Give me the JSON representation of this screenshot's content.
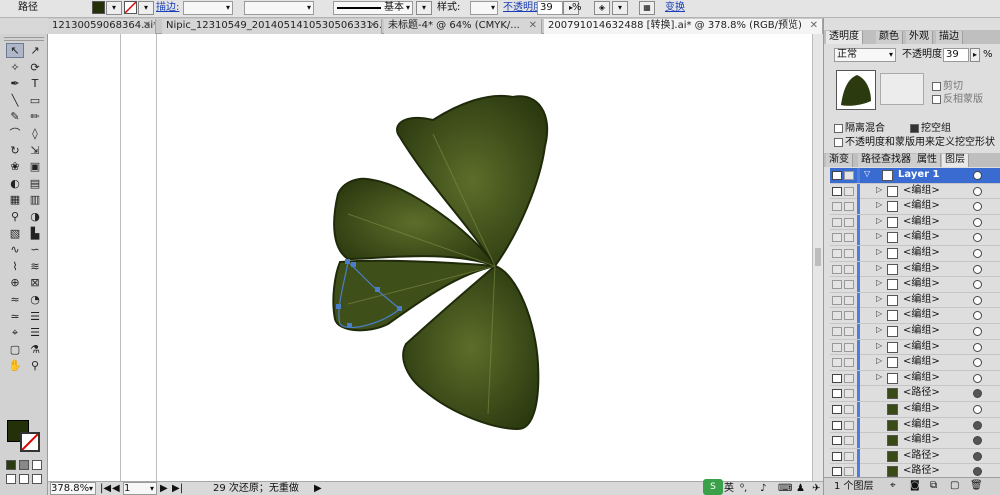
{
  "control_bar": {
    "object_type": "路径",
    "stroke_label": "描边:",
    "stroke_profile": "基本",
    "style_label": "样式:",
    "opacity_label": "不透明度:",
    "opacity_value": "39",
    "opacity_unit": "%",
    "transform_label": "变换"
  },
  "tabs": [
    {
      "label": "12130059068364.ai*"
    },
    {
      "label": "Nipic_12310549_20140514105305063316.ai*"
    },
    {
      "label": "未标题-4* @ 64% (CMYK/..."
    },
    {
      "label": "200791014632488 [转换].ai* @ 378.8% (RGB/预览)"
    }
  ],
  "status": {
    "zoom": "378.8%",
    "page": "1",
    "undo_text": "29 次还原；无重做"
  },
  "ime": {
    "mode": "英"
  },
  "transparency_panel": {
    "tabs": [
      "透明度",
      "颜色",
      "外观",
      "描边"
    ],
    "blend_mode": "正常",
    "opacity_label": "不透明度:",
    "opacity_value": "39",
    "opacity_unit": "%",
    "clip_label": "剪切",
    "invert_mask_label": "反相蒙版",
    "isolate_label": "隔离混合",
    "knockout_label": "挖空组",
    "define_knockout_label": "不透明度和蒙版用来定义挖空形状"
  },
  "layers_panel": {
    "tabs": [
      "渐变",
      "路径查找器",
      "属性",
      "图层"
    ],
    "rows": [
      {
        "name": "Layer 1",
        "top": true,
        "eye": true,
        "tri": "▽",
        "target_filled": false
      },
      {
        "name": "<编组>",
        "eye": true,
        "tri": "▷",
        "target_filled": false
      },
      {
        "name": "<编组>",
        "eye": false,
        "tri": "▷",
        "target_filled": false
      },
      {
        "name": "<编组>",
        "eye": false,
        "tri": "▷",
        "target_filled": false
      },
      {
        "name": "<编组>",
        "eye": false,
        "tri": "▷",
        "target_filled": false
      },
      {
        "name": "<编组>",
        "eye": false,
        "tri": "▷",
        "target_filled": false
      },
      {
        "name": "<编组>",
        "eye": false,
        "tri": "▷",
        "target_filled": false
      },
      {
        "name": "<编组>",
        "eye": false,
        "tri": "▷",
        "target_filled": false
      },
      {
        "name": "<编组>",
        "eye": false,
        "tri": "▷",
        "target_filled": false
      },
      {
        "name": "<编组>",
        "eye": false,
        "tri": "▷",
        "target_filled": false
      },
      {
        "name": "<编组>",
        "eye": false,
        "tri": "▷",
        "target_filled": false
      },
      {
        "name": "<编组>",
        "eye": false,
        "tri": "▷",
        "target_filled": false
      },
      {
        "name": "<编组>",
        "eye": false,
        "tri": "▷",
        "target_filled": false
      },
      {
        "name": "<编组>",
        "eye": true,
        "tri": "▷",
        "target_filled": false
      },
      {
        "name": "<路径>",
        "eye": true,
        "tri": "",
        "target_filled": true
      },
      {
        "name": "<编组>",
        "eye": true,
        "tri": "",
        "target_filled": false
      },
      {
        "name": "<编组>",
        "eye": true,
        "tri": "",
        "target_filled": true
      },
      {
        "name": "<编组>",
        "eye": true,
        "tri": "",
        "target_filled": true
      },
      {
        "name": "<路径>",
        "eye": true,
        "tri": "",
        "target_filled": true
      },
      {
        "name": "<路径>",
        "eye": true,
        "tri": "",
        "target_filled": true
      }
    ],
    "footer_count": "1 个图层"
  },
  "tools": [
    {
      "glyph": "↖",
      "name": "selection-tool",
      "sel": true
    },
    {
      "glyph": "↗",
      "name": "direct-selection-tool"
    },
    {
      "glyph": "✧",
      "name": "magic-wand-tool"
    },
    {
      "glyph": "⟳",
      "name": "lasso-tool"
    },
    {
      "glyph": "✒",
      "name": "pen-tool"
    },
    {
      "glyph": "T",
      "name": "type-tool"
    },
    {
      "glyph": "╲",
      "name": "line-tool"
    },
    {
      "glyph": "▭",
      "name": "rectangle-tool"
    },
    {
      "glyph": "✎",
      "name": "paintbrush-tool"
    },
    {
      "glyph": "✏",
      "name": "pencil-tool"
    },
    {
      "glyph": "⌒",
      "name": "blob-brush-tool"
    },
    {
      "glyph": "◊",
      "name": "eraser-tool"
    },
    {
      "glyph": "↻",
      "name": "rotate-tool"
    },
    {
      "glyph": "⇲",
      "name": "scale-tool"
    },
    {
      "glyph": "❀",
      "name": "warp-tool"
    },
    {
      "glyph": "▣",
      "name": "free-transform-tool"
    },
    {
      "glyph": "◐",
      "name": "shape-builder-tool"
    },
    {
      "glyph": "▤",
      "name": "perspective-grid-tool"
    },
    {
      "glyph": "▦",
      "name": "mesh-tool"
    },
    {
      "glyph": "▥",
      "name": "gradient-tool"
    },
    {
      "glyph": "⚲",
      "name": "eyedropper-tool"
    },
    {
      "glyph": "◑",
      "name": "blend-tool"
    },
    {
      "glyph": "▧",
      "name": "symbol-sprayer-tool"
    },
    {
      "glyph": "▙",
      "name": "column-graph-tool"
    },
    {
      "glyph": "∿",
      "name": "artboard-tool"
    },
    {
      "glyph": "∽",
      "name": "slice-tool"
    },
    {
      "glyph": "⌇",
      "name": "width-tool"
    },
    {
      "glyph": "≋",
      "name": "reshape-tool"
    },
    {
      "glyph": "⊕",
      "name": "symbol-tool"
    },
    {
      "glyph": "⊠",
      "name": "crop-tool"
    },
    {
      "glyph": "≈",
      "name": "wave-tool"
    },
    {
      "glyph": "◔",
      "name": "scissors-tool"
    },
    {
      "glyph": "≃",
      "name": "knife-tool"
    },
    {
      "glyph": "☰",
      "name": "live-paint-tool"
    },
    {
      "glyph": "⌖",
      "name": "live-paint-select-tool"
    },
    {
      "glyph": "☰",
      "name": "paint-bucket-tool"
    },
    {
      "glyph": "▢",
      "name": "artboard-2-tool"
    },
    {
      "glyph": "⚗",
      "name": "measure-tool"
    },
    {
      "glyph": "✋",
      "name": "hand-tool"
    },
    {
      "glyph": "⚲",
      "name": "zoom-tool"
    }
  ],
  "colors": {
    "fill": "#243008",
    "leaf_dark": "#2e3d12",
    "leaf_mid": "#4a5a1f",
    "leaf_light": "#667a32",
    "outline": "#1f2a0a",
    "selection": "#4a7ec9"
  }
}
